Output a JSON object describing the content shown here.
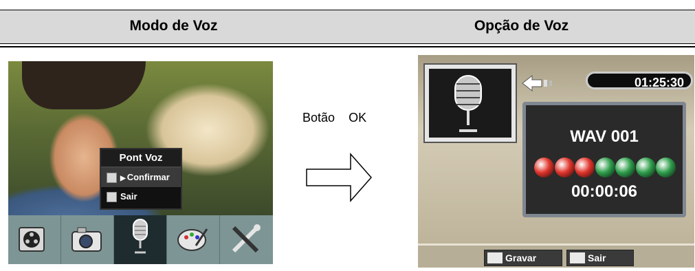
{
  "headers": {
    "left": "Modo de Voz",
    "right": "Opção de Voz"
  },
  "left_screen": {
    "popup": {
      "title": "Pont Voz",
      "items": [
        {
          "label": "Confirmar",
          "icon": "microphone-icon",
          "selected": true
        },
        {
          "label": "Sair",
          "icon": "exit-icon",
          "selected": false
        }
      ]
    },
    "mode_bar": [
      {
        "icon": "film-reel-icon",
        "active": false
      },
      {
        "icon": "camera-icon",
        "active": false
      },
      {
        "icon": "microphone-icon",
        "active": true
      },
      {
        "icon": "palette-icon",
        "active": false
      },
      {
        "icon": "tools-icon",
        "active": false
      }
    ]
  },
  "transition": {
    "button_label_1": "Botão",
    "button_label_2": "OK",
    "icon": "right-arrow-icon"
  },
  "right_screen": {
    "time_remaining": "01:25:30",
    "file_name": "WAV 001",
    "elapsed": "00:00:06",
    "level_dots": [
      "red",
      "red",
      "red",
      "green",
      "green",
      "green",
      "green"
    ],
    "colors": {
      "red": "#e0352c",
      "green": "#2f9e4c"
    },
    "buttons": {
      "record": "Gravar",
      "exit": "Sair"
    }
  }
}
